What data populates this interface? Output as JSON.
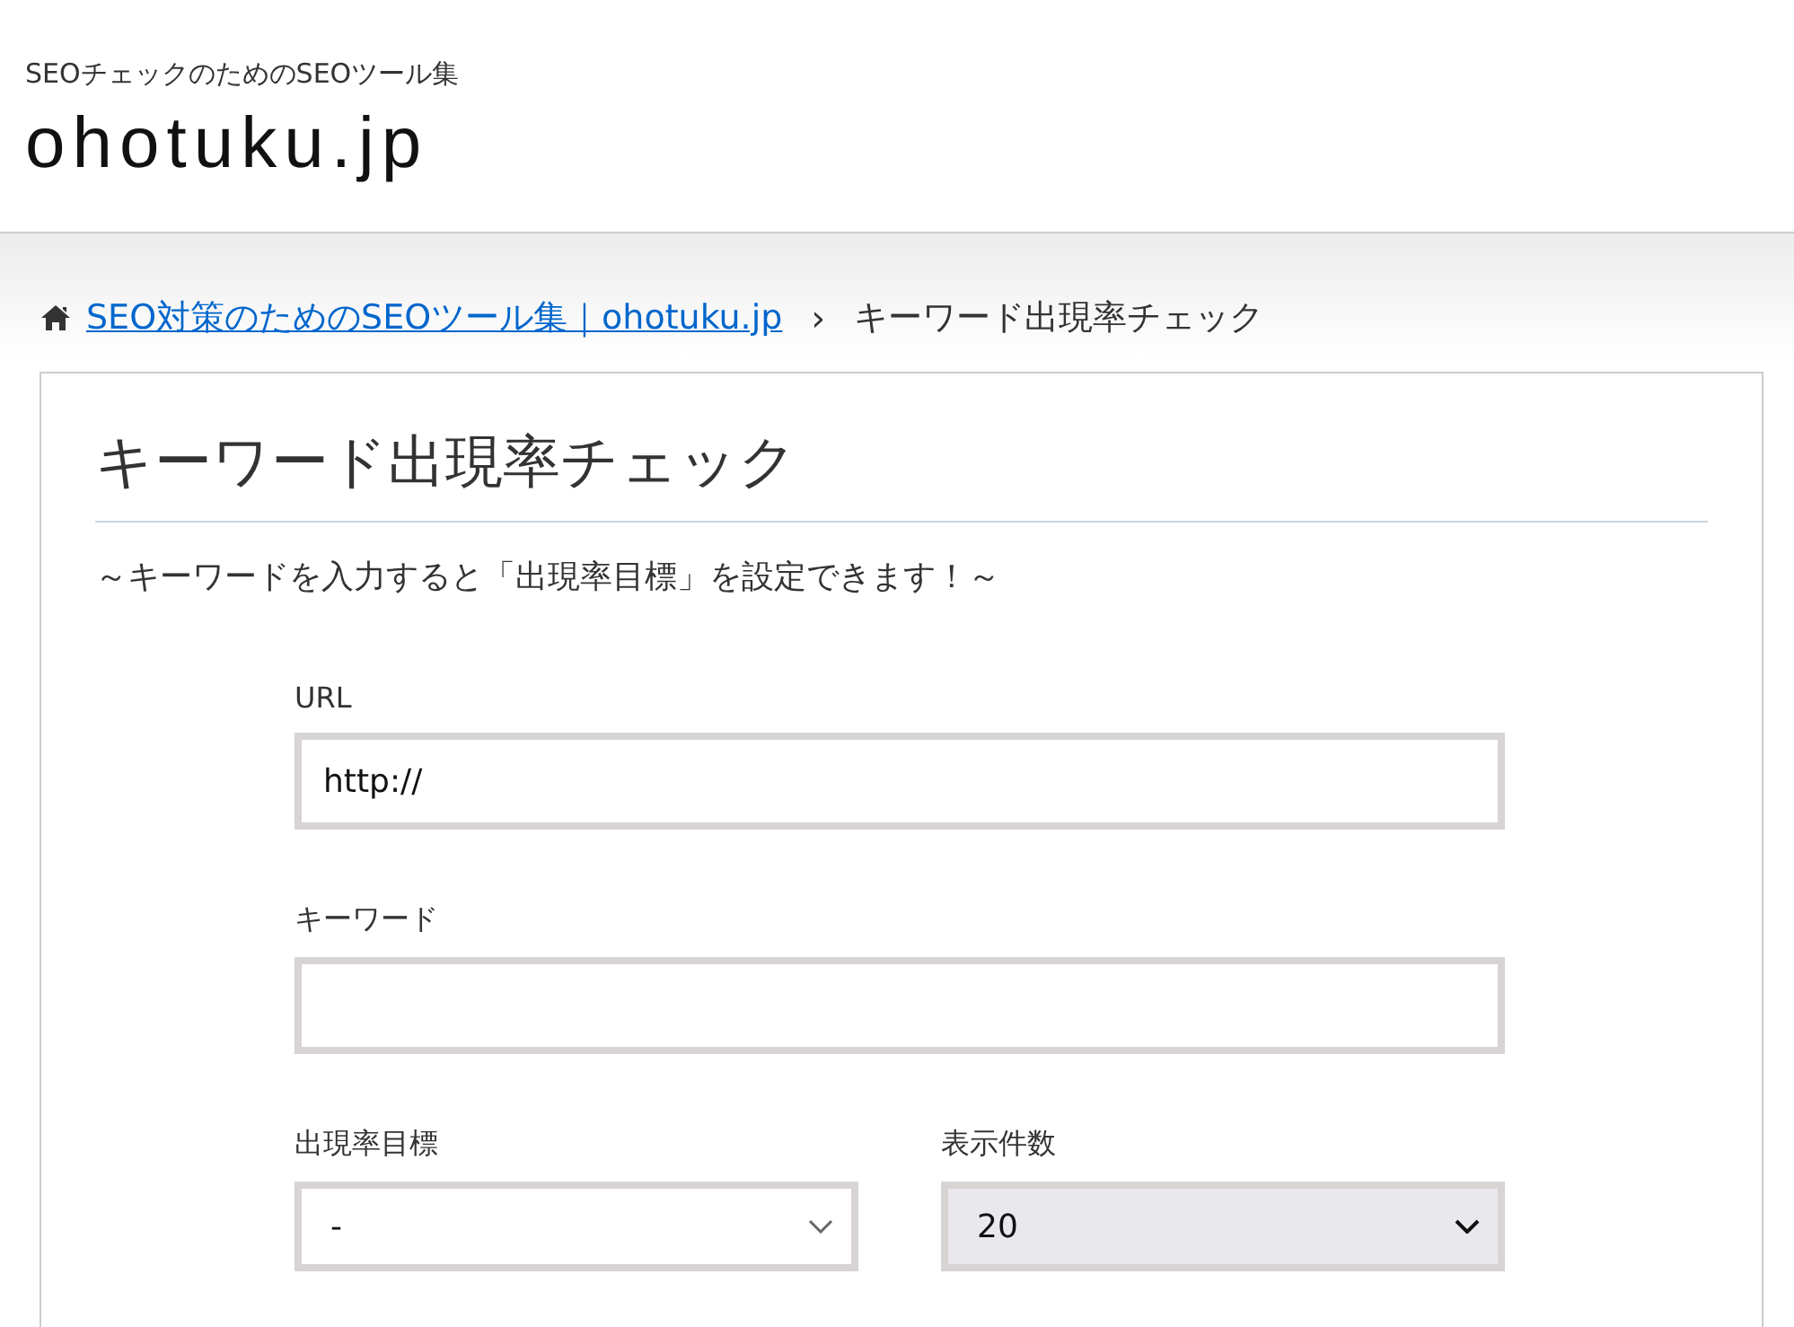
{
  "header": {
    "tagline": "SEOチェックのためのSEOツール集",
    "logo": "ohotuku.jp"
  },
  "breadcrumb": {
    "home_link": "SEO対策のためのSEOツール集｜ohotuku.jp",
    "separator": "›",
    "current": "キーワード出現率チェック"
  },
  "page": {
    "title": "キーワード出現率チェック",
    "subtitle": "～キーワードを入力すると「出現率目標」を設定できます！～"
  },
  "fields": [
    {
      "label": "URL",
      "value": "http://"
    },
    {
      "label": "キーワード"
    }
  ],
  "selects": [
    {
      "label": "出現率目標",
      "value": "-",
      "kind": "plain"
    },
    {
      "label": "表示件数",
      "value": "20",
      "kind": "filled"
    }
  ]
}
